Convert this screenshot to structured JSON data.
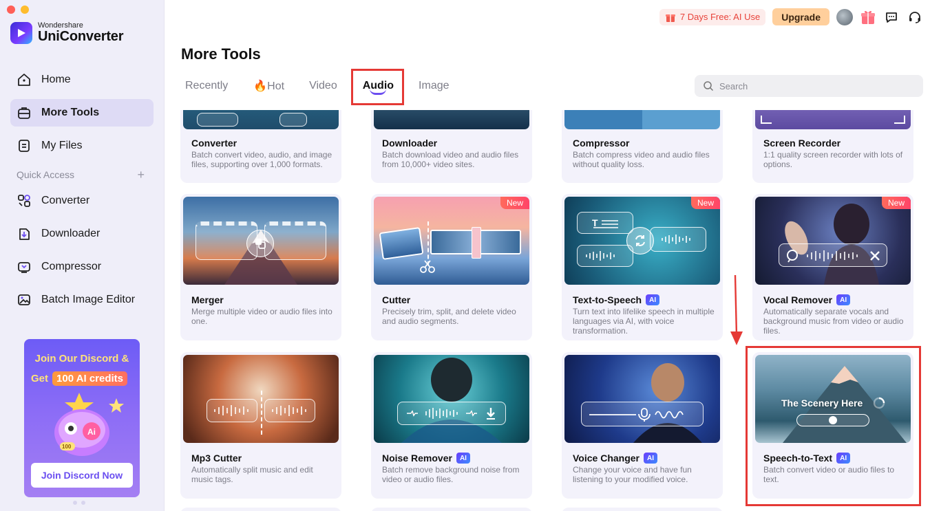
{
  "app": {
    "brand_small": "Wondershare",
    "brand_name": "UniConverter"
  },
  "sidebar": {
    "nav": [
      {
        "label": "Home",
        "icon": "home-icon"
      },
      {
        "label": "More Tools",
        "icon": "toolbox-icon",
        "active": true
      },
      {
        "label": "My Files",
        "icon": "file-icon"
      }
    ],
    "quick_access_label": "Quick Access",
    "quick_access_add": "+",
    "quick_access": [
      {
        "label": "Converter",
        "icon": "converter-icon"
      },
      {
        "label": "Downloader",
        "icon": "downloader-icon"
      },
      {
        "label": "Compressor",
        "icon": "compressor-icon"
      },
      {
        "label": "Batch Image Editor",
        "icon": "image-editor-icon"
      }
    ],
    "promo": {
      "line1": "Join Our Discord &",
      "line2_prefix": "Get",
      "line2_pill": "100 AI credits",
      "coin_label": "100",
      "button": "Join Discord Now"
    }
  },
  "topbar": {
    "trial": "7 Days Free: AI Use",
    "upgrade": "Upgrade"
  },
  "main": {
    "title": "More Tools",
    "tabs": [
      {
        "label": "Recently"
      },
      {
        "label": "🔥Hot"
      },
      {
        "label": "Video"
      },
      {
        "label": "Audio",
        "active": true
      },
      {
        "label": "Image"
      }
    ],
    "search_placeholder": "Search"
  },
  "cards": [
    {
      "title": "Converter",
      "desc": "Batch convert video, audio, and image files, supporting over 1,000 formats."
    },
    {
      "title": "Downloader",
      "desc": "Batch download video and audio files from 10,000+ video sites."
    },
    {
      "title": "Compressor",
      "desc": "Batch compress video and audio files without quality loss."
    },
    {
      "title": "Screen Recorder",
      "desc": "1:1 quality screen recorder with lots of options."
    },
    {
      "title": "Merger",
      "desc": "Merge multiple video or audio files into one."
    },
    {
      "title": "Cutter",
      "desc": "Precisely trim, split, and delete video and audio segments.",
      "badge": "New"
    },
    {
      "title": "Text-to-Speech",
      "desc": "Turn text into lifelike speech in multiple languages via AI, with voice transformation.",
      "badge": "New",
      "ai": "AI"
    },
    {
      "title": "Vocal Remover",
      "desc": "Automatically separate vocals and background music from video or audio files.",
      "badge": "New",
      "ai": "AI"
    },
    {
      "title": "Mp3 Cutter",
      "desc": "Automatically split music and edit music tags."
    },
    {
      "title": "Noise Remover",
      "desc": "Batch remove background noise from video or audio files.",
      "ai": "AI"
    },
    {
      "title": "Voice Changer",
      "desc": "Change your voice and have fun listening to your modified voice.",
      "ai": "AI"
    },
    {
      "title": "Speech-to-Text",
      "desc": "Batch convert video or audio files to text.",
      "ai": "AI",
      "overlay_text": "The Scenery Here"
    }
  ],
  "colors": {
    "accent": "#6b4df0",
    "highlight_red": "#e53935",
    "sidebar_bg": "#efeef9",
    "card_bg": "#f3f2fb"
  }
}
